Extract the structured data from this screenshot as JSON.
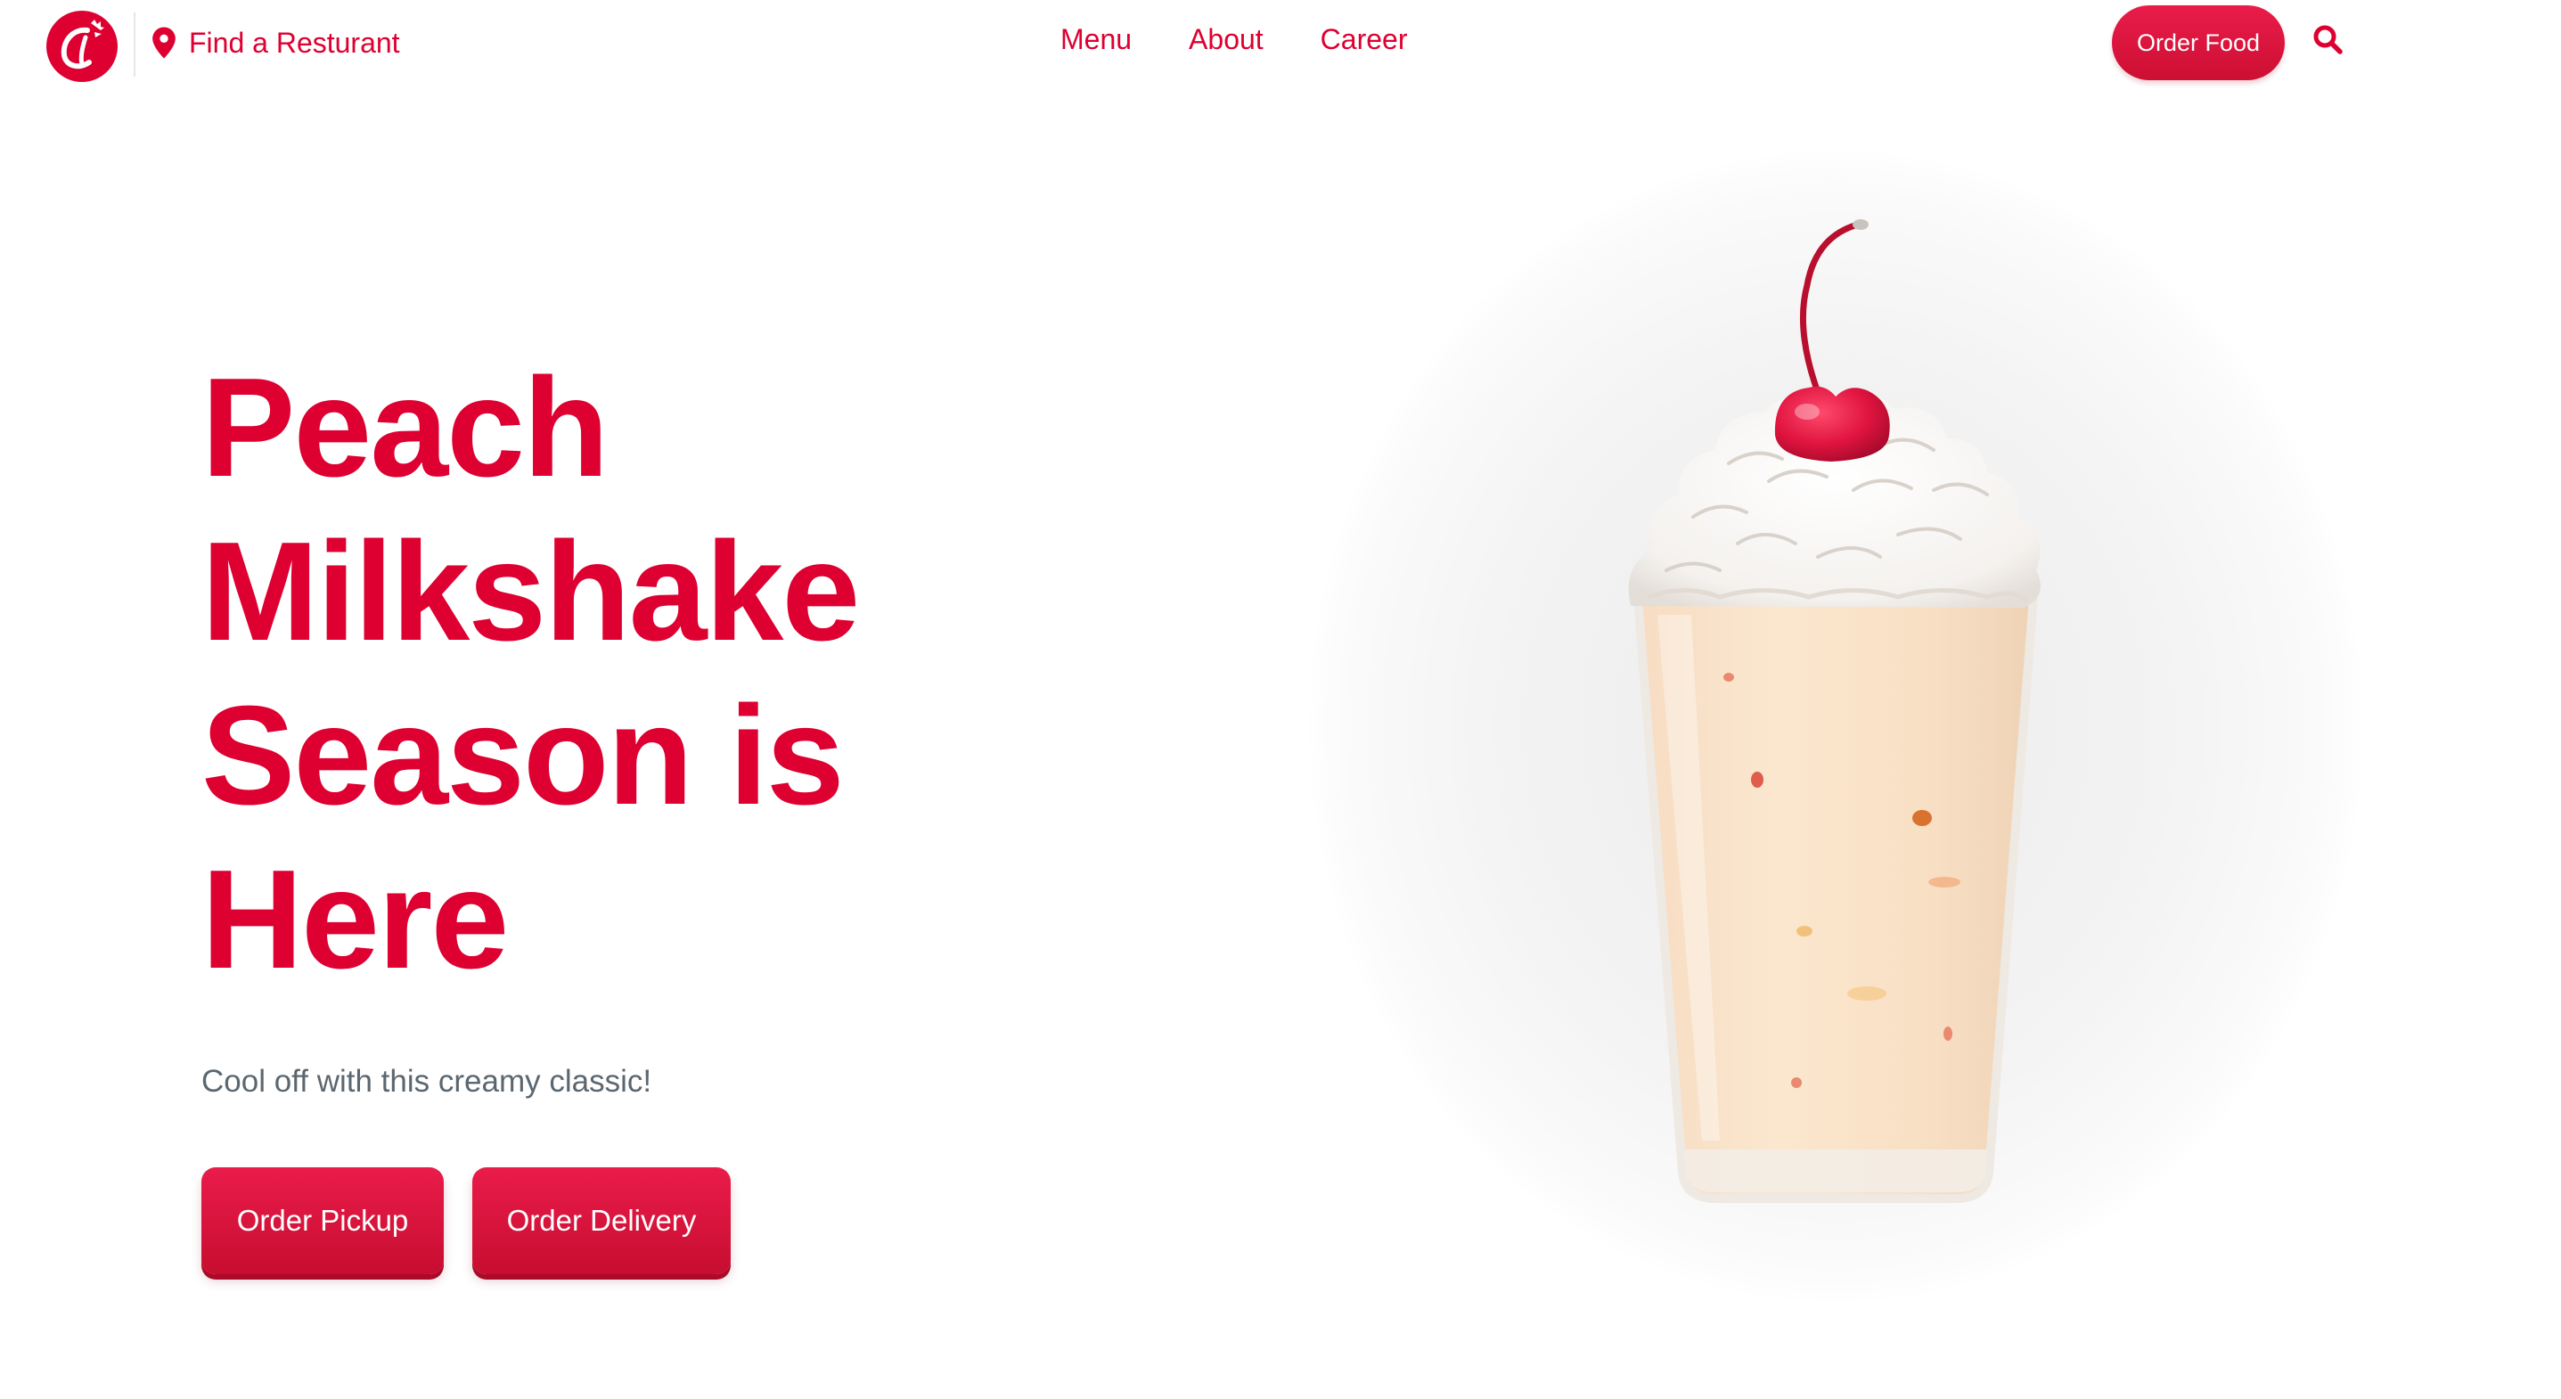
{
  "header": {
    "find_restaurant_label": "Find a Resturant",
    "nav_items": [
      {
        "label": "Menu"
      },
      {
        "label": "About"
      },
      {
        "label": "Career"
      }
    ],
    "order_food_label": "Order Food"
  },
  "hero": {
    "title_lines": [
      "Peach",
      "Milkshake",
      "Season is",
      "Here"
    ],
    "subtitle": "Cool off with this creamy classic!",
    "buttons": {
      "pickup": "Order Pickup",
      "delivery": "Order Delivery"
    }
  },
  "icons": {
    "logo": "chick-fil-a-logo",
    "location": "map-pin-icon",
    "search": "search-icon"
  },
  "colors": {
    "brand_red": "#dd0031",
    "subtitle_gray": "#5b6770",
    "background": "#ffffff"
  }
}
